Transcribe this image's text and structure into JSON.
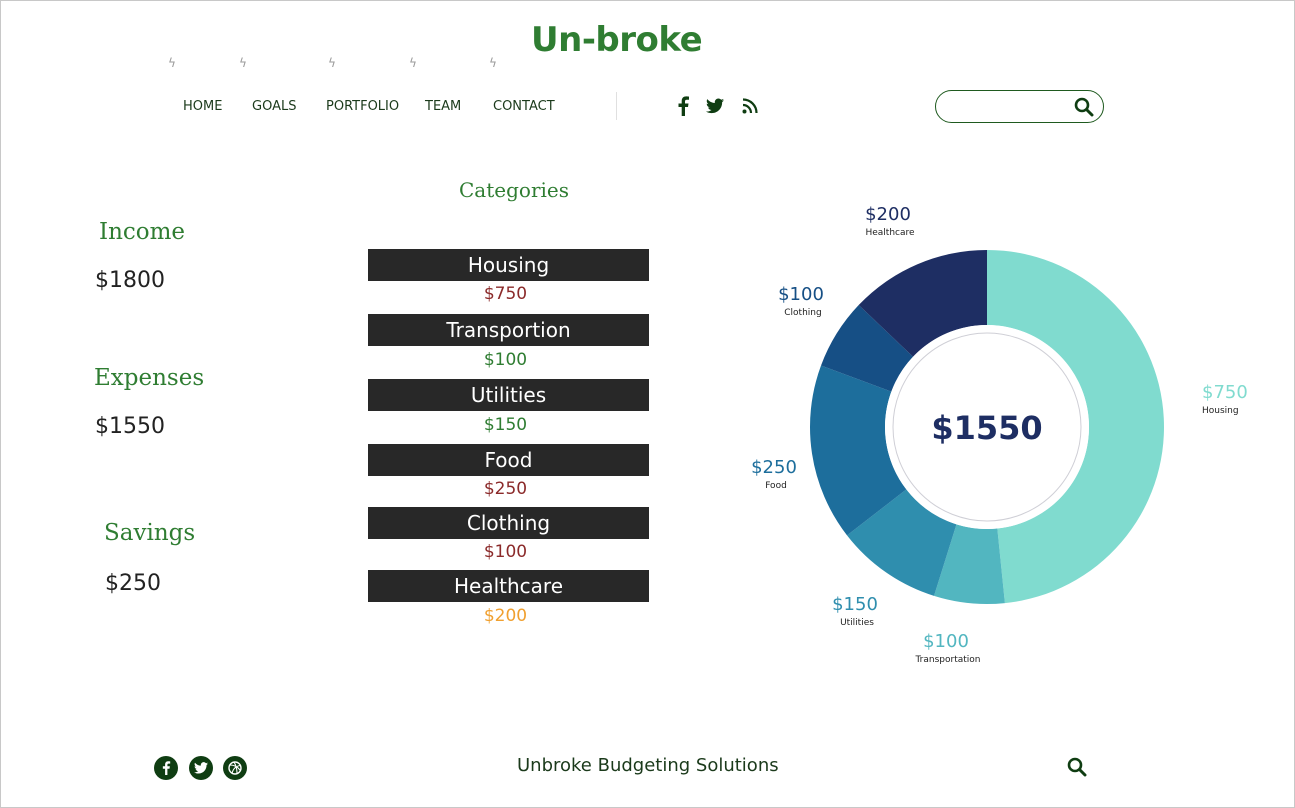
{
  "header": {
    "logo": "Un-broke",
    "nav": [
      "HOME",
      "GOALS",
      "PORTFOLIO",
      "TEAM",
      "CONTACT"
    ],
    "social_icons": [
      "facebook-icon",
      "twitter-icon",
      "rss-icon"
    ],
    "search_placeholder": ""
  },
  "summary": {
    "income_label": "Income",
    "income_value": "$1800",
    "expenses_label": "Expenses",
    "expenses_value": "$1550",
    "savings_label": "Savings",
    "savings_value": "$250"
  },
  "categories": {
    "title": "Categories",
    "items": [
      {
        "name": "Housing",
        "amount": "$750",
        "color": "#8b2a2a"
      },
      {
        "name": "Transportion",
        "amount": "$100",
        "color": "#2f7d32"
      },
      {
        "name": "Utilities",
        "amount": "$150",
        "color": "#2f7d32"
      },
      {
        "name": "Food",
        "amount": "$250",
        "color": "#8b2a2a"
      },
      {
        "name": "Clothing",
        "amount": "$100",
        "color": "#8b2a2a"
      },
      {
        "name": "Healthcare",
        "amount": "$200",
        "color": "#f0a030"
      }
    ]
  },
  "chart_data": {
    "type": "pie",
    "center_label": "$1550",
    "slices": [
      {
        "label": "Housing",
        "value": 750,
        "value_label": "$750",
        "color": "#80dbcf"
      },
      {
        "label": "Transportation",
        "value": 100,
        "value_label": "$100",
        "color": "#52b6c0"
      },
      {
        "label": "Utilities",
        "value": 150,
        "value_label": "$150",
        "color": "#2f8eae"
      },
      {
        "label": "Food",
        "value": 250,
        "value_label": "$250",
        "color": "#1d6e9c"
      },
      {
        "label": "Clothing",
        "value": 100,
        "value_label": "$100",
        "color": "#164f85"
      },
      {
        "label": "Healthcare",
        "value": 200,
        "value_label": "$200",
        "color": "#1e2e63"
      }
    ]
  },
  "footer": {
    "title": "Unbroke Budgeting Solutions",
    "social_icons": [
      "facebook-icon",
      "twitter-icon",
      "dribbble-icon"
    ]
  }
}
